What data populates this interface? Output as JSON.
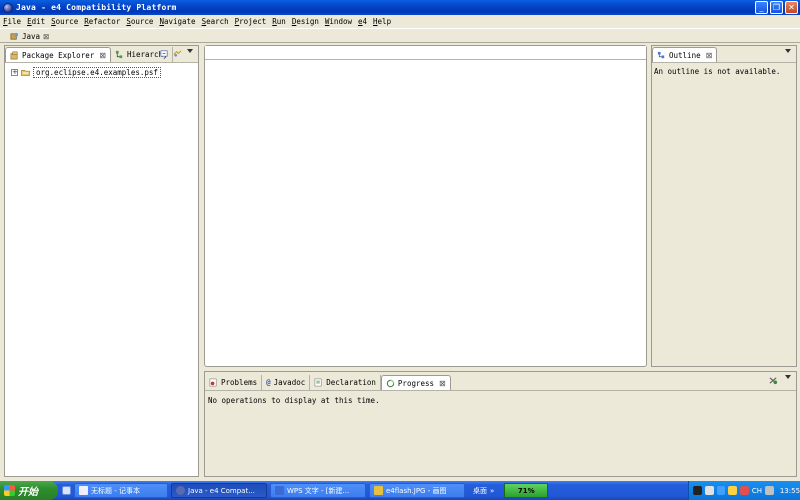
{
  "window": {
    "title": "Java - e4 Compatibility Platform"
  },
  "menu": [
    "File",
    "Edit",
    "Source",
    "Refactor",
    "Source",
    "Navigate",
    "Search",
    "Project",
    "Run",
    "Design",
    "Window",
    "e4",
    "Help"
  ],
  "perspective": {
    "label": "Java"
  },
  "package_explorer": {
    "tabs": [
      {
        "label": "Package Explorer",
        "active": true
      },
      {
        "label": "Hierarchy",
        "active": false
      }
    ],
    "tree": [
      {
        "label": "org.eclipse.e4.examples.psf",
        "expanded": false
      }
    ]
  },
  "outline": {
    "tab_label": "Outline",
    "message": "An outline is not available."
  },
  "bottom_panel": {
    "tabs": [
      {
        "label": "Problems",
        "active": false
      },
      {
        "label": "Javadoc",
        "active": false
      },
      {
        "label": "Declaration",
        "active": false
      },
      {
        "label": "Progress",
        "active": true
      }
    ],
    "message": "No operations to display at this time."
  },
  "taskbar": {
    "start_label": "开始",
    "tasks": [
      {
        "label": "无标题 - 记事本",
        "active": false
      },
      {
        "label": "Java - e4 Compat...",
        "active": true
      },
      {
        "label": "WPS 文字 - [新建...",
        "active": false
      },
      {
        "label": "e4flash.JPG - 画图",
        "active": false
      }
    ],
    "desktop_label": "桌面",
    "battery": "71%",
    "tray_text": "CH",
    "clock": "13:55"
  }
}
